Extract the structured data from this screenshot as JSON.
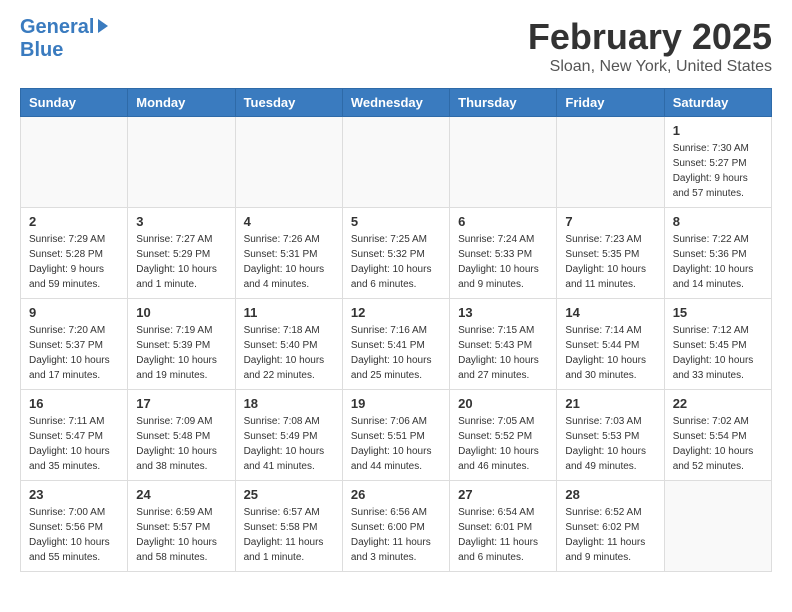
{
  "header": {
    "logo_general": "General",
    "logo_blue": "Blue",
    "title": "February 2025",
    "subtitle": "Sloan, New York, United States"
  },
  "weekdays": [
    "Sunday",
    "Monday",
    "Tuesday",
    "Wednesday",
    "Thursday",
    "Friday",
    "Saturday"
  ],
  "weeks": [
    [
      {
        "day": "",
        "info": ""
      },
      {
        "day": "",
        "info": ""
      },
      {
        "day": "",
        "info": ""
      },
      {
        "day": "",
        "info": ""
      },
      {
        "day": "",
        "info": ""
      },
      {
        "day": "",
        "info": ""
      },
      {
        "day": "1",
        "info": "Sunrise: 7:30 AM\nSunset: 5:27 PM\nDaylight: 9 hours and 57 minutes."
      }
    ],
    [
      {
        "day": "2",
        "info": "Sunrise: 7:29 AM\nSunset: 5:28 PM\nDaylight: 9 hours and 59 minutes."
      },
      {
        "day": "3",
        "info": "Sunrise: 7:27 AM\nSunset: 5:29 PM\nDaylight: 10 hours and 1 minute."
      },
      {
        "day": "4",
        "info": "Sunrise: 7:26 AM\nSunset: 5:31 PM\nDaylight: 10 hours and 4 minutes."
      },
      {
        "day": "5",
        "info": "Sunrise: 7:25 AM\nSunset: 5:32 PM\nDaylight: 10 hours and 6 minutes."
      },
      {
        "day": "6",
        "info": "Sunrise: 7:24 AM\nSunset: 5:33 PM\nDaylight: 10 hours and 9 minutes."
      },
      {
        "day": "7",
        "info": "Sunrise: 7:23 AM\nSunset: 5:35 PM\nDaylight: 10 hours and 11 minutes."
      },
      {
        "day": "8",
        "info": "Sunrise: 7:22 AM\nSunset: 5:36 PM\nDaylight: 10 hours and 14 minutes."
      }
    ],
    [
      {
        "day": "9",
        "info": "Sunrise: 7:20 AM\nSunset: 5:37 PM\nDaylight: 10 hours and 17 minutes."
      },
      {
        "day": "10",
        "info": "Sunrise: 7:19 AM\nSunset: 5:39 PM\nDaylight: 10 hours and 19 minutes."
      },
      {
        "day": "11",
        "info": "Sunrise: 7:18 AM\nSunset: 5:40 PM\nDaylight: 10 hours and 22 minutes."
      },
      {
        "day": "12",
        "info": "Sunrise: 7:16 AM\nSunset: 5:41 PM\nDaylight: 10 hours and 25 minutes."
      },
      {
        "day": "13",
        "info": "Sunrise: 7:15 AM\nSunset: 5:43 PM\nDaylight: 10 hours and 27 minutes."
      },
      {
        "day": "14",
        "info": "Sunrise: 7:14 AM\nSunset: 5:44 PM\nDaylight: 10 hours and 30 minutes."
      },
      {
        "day": "15",
        "info": "Sunrise: 7:12 AM\nSunset: 5:45 PM\nDaylight: 10 hours and 33 minutes."
      }
    ],
    [
      {
        "day": "16",
        "info": "Sunrise: 7:11 AM\nSunset: 5:47 PM\nDaylight: 10 hours and 35 minutes."
      },
      {
        "day": "17",
        "info": "Sunrise: 7:09 AM\nSunset: 5:48 PM\nDaylight: 10 hours and 38 minutes."
      },
      {
        "day": "18",
        "info": "Sunrise: 7:08 AM\nSunset: 5:49 PM\nDaylight: 10 hours and 41 minutes."
      },
      {
        "day": "19",
        "info": "Sunrise: 7:06 AM\nSunset: 5:51 PM\nDaylight: 10 hours and 44 minutes."
      },
      {
        "day": "20",
        "info": "Sunrise: 7:05 AM\nSunset: 5:52 PM\nDaylight: 10 hours and 46 minutes."
      },
      {
        "day": "21",
        "info": "Sunrise: 7:03 AM\nSunset: 5:53 PM\nDaylight: 10 hours and 49 minutes."
      },
      {
        "day": "22",
        "info": "Sunrise: 7:02 AM\nSunset: 5:54 PM\nDaylight: 10 hours and 52 minutes."
      }
    ],
    [
      {
        "day": "23",
        "info": "Sunrise: 7:00 AM\nSunset: 5:56 PM\nDaylight: 10 hours and 55 minutes."
      },
      {
        "day": "24",
        "info": "Sunrise: 6:59 AM\nSunset: 5:57 PM\nDaylight: 10 hours and 58 minutes."
      },
      {
        "day": "25",
        "info": "Sunrise: 6:57 AM\nSunset: 5:58 PM\nDaylight: 11 hours and 1 minute."
      },
      {
        "day": "26",
        "info": "Sunrise: 6:56 AM\nSunset: 6:00 PM\nDaylight: 11 hours and 3 minutes."
      },
      {
        "day": "27",
        "info": "Sunrise: 6:54 AM\nSunset: 6:01 PM\nDaylight: 11 hours and 6 minutes."
      },
      {
        "day": "28",
        "info": "Sunrise: 6:52 AM\nSunset: 6:02 PM\nDaylight: 11 hours and 9 minutes."
      },
      {
        "day": "",
        "info": ""
      }
    ]
  ]
}
